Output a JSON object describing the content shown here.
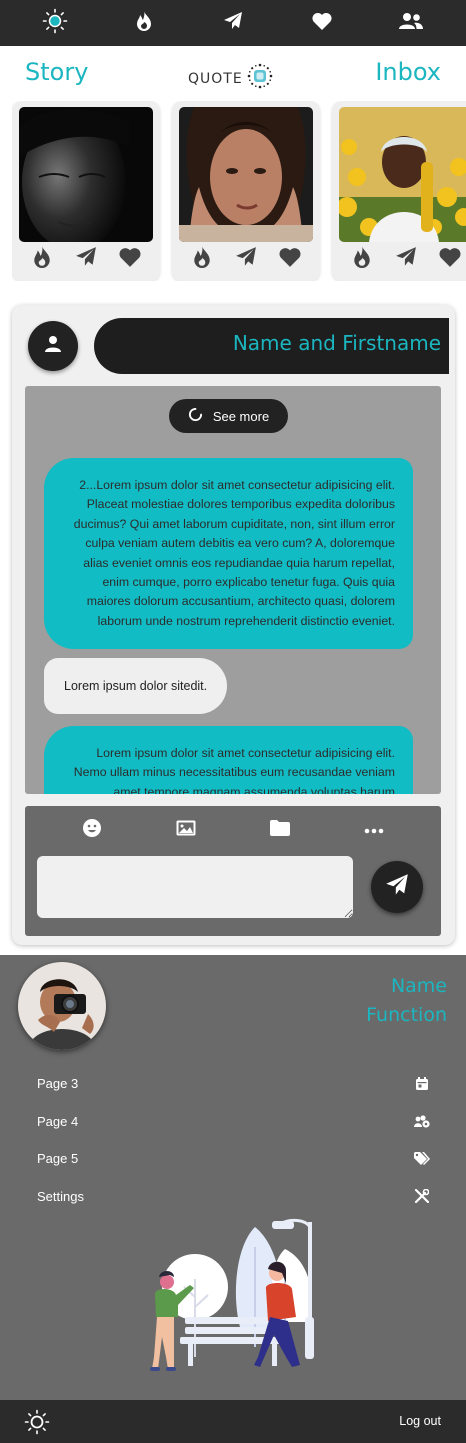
{
  "topnav": {
    "items": [
      {
        "icon": "sun-logo-icon",
        "label": ""
      },
      {
        "icon": "flame-icon",
        "label": ""
      },
      {
        "icon": "paper-plane-icon",
        "label": ""
      },
      {
        "icon": "heart-icon",
        "label": ""
      },
      {
        "icon": "users-icon",
        "label": ""
      }
    ]
  },
  "header": {
    "story_tab": "Story",
    "inbox_tab": "Inbox",
    "logo_text": "QUOTE"
  },
  "stories": [
    {
      "image": "portrait-bw-man",
      "actions": [
        "flame-icon",
        "paper-plane-icon",
        "heart-icon"
      ]
    },
    {
      "image": "portrait-woman-hands",
      "actions": [
        "flame-icon",
        "paper-plane-icon",
        "heart-icon"
      ]
    },
    {
      "image": "portrait-woman-flowers",
      "actions": [
        "flame-icon",
        "paper-plane-icon",
        "heart-icon"
      ]
    }
  ],
  "chat": {
    "contact_name": "Name and Firstname",
    "see_more": "See more",
    "messages": [
      {
        "from": "me",
        "text": "2...Lorem ipsum dolor sit amet consectetur adipisicing elit. Placeat molestiae dolores temporibus expedita doloribus ducimus? Qui amet laborum cupiditate, non, sint illum error culpa veniam autem debitis ea vero cum? A, doloremque alias eveniet omnis eos repudiandae quia harum repellat, enim cumque, porro explicabo tenetur fuga. Quis quia maiores dolorum accusantium, architecto quasi, dolorem laborum unde nostrum reprehenderit distinctio eveniet."
      },
      {
        "from": "them",
        "text": "Lorem ipsum dolor sitedit."
      },
      {
        "from": "me",
        "text": "Lorem ipsum dolor sit amet consectetur adipisicing elit. Nemo ullam minus necessitatibus eum recusandae veniam amet tempore magnam assumenda voluptas harum"
      }
    ],
    "composer": {
      "tools": [
        "smiley-icon",
        "image-icon",
        "folder-icon",
        "more-dots-icon"
      ],
      "input_value": "",
      "input_placeholder": "",
      "send_icon": "paper-plane-icon"
    }
  },
  "sidebar": {
    "name": "Name",
    "function": "Function",
    "menu": [
      {
        "label": "Page 3",
        "icon": "calendar-icon"
      },
      {
        "label": "Page 4",
        "icon": "users-cog-icon"
      },
      {
        "label": "Page 5",
        "icon": "tags-icon"
      },
      {
        "label": "Settings",
        "icon": "tools-icon"
      }
    ]
  },
  "footer": {
    "logout": "Log out"
  },
  "colors": {
    "accent": "#1bb6c0",
    "dark": "#2b2b2b",
    "panel": "#6a6a6a",
    "bubble_out": "#12bcc4"
  }
}
